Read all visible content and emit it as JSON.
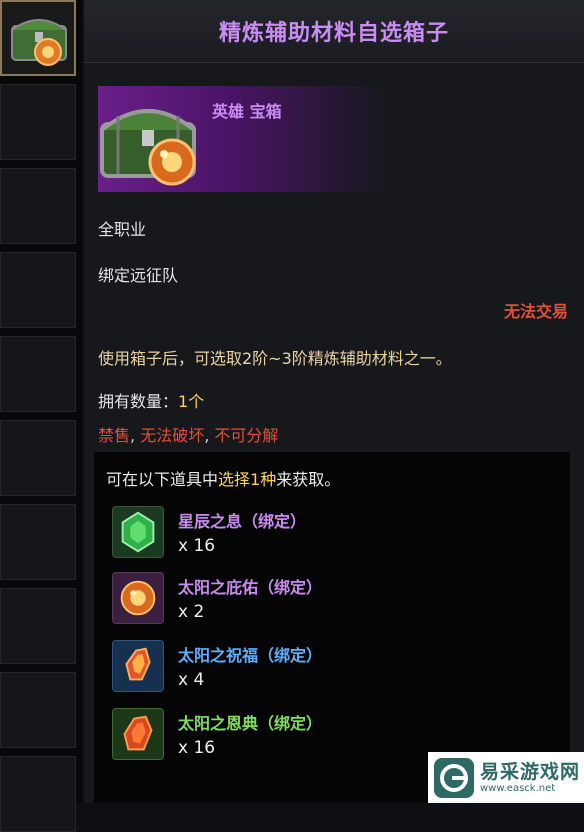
{
  "title": "精炼辅助材料自选箱子",
  "item": {
    "rarity": "英雄 宝箱",
    "class_restriction": "全职业",
    "binding": "绑定远征队",
    "trade_status": "无法交易",
    "description": "使用箱子后，可选取2阶~3阶精炼辅助材料之一。",
    "owned_label": "拥有数量：",
    "owned_count": "1个",
    "warnings": [
      "禁售",
      "无法破坏",
      "不可分解"
    ],
    "warning_separator": ", "
  },
  "choice": {
    "header_prefix": "可在以下道具中",
    "header_highlight": "选择1种",
    "header_suffix": "来获取。",
    "rewards": [
      {
        "name": "星辰之息（绑定）",
        "count": "x 16",
        "name_color": "#c98bf0",
        "icon": "green-gem-icon"
      },
      {
        "name": "太阳之庇佑（绑定）",
        "count": "x 2",
        "name_color": "#c98bf0",
        "icon": "orange-gem-icon"
      },
      {
        "name": "太阳之祝福（绑定）",
        "count": "x 4",
        "name_color": "#5ab0ff",
        "icon": "sun-blessing-icon"
      },
      {
        "name": "太阳之恩典（绑定）",
        "count": "x 16",
        "name_color": "#7ee05a",
        "icon": "sun-grace-icon"
      }
    ]
  },
  "watermark": {
    "name": "易采游戏网",
    "url": "www.easck.net"
  }
}
